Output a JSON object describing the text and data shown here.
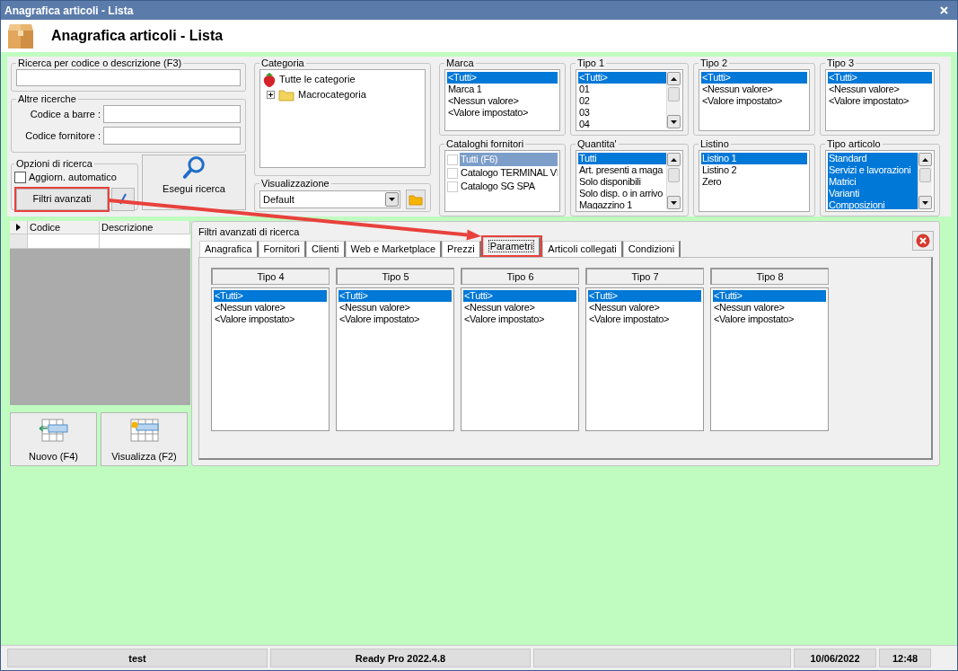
{
  "window": {
    "title": "Anagrafica articoli  - Lista"
  },
  "header": {
    "title": "Anagrafica articoli  - Lista"
  },
  "search": {
    "label": "Ricerca per codice o descrizione (F3)"
  },
  "other_searches": {
    "label": "Altre ricerche",
    "fields": [
      {
        "label": "Codice a barre :"
      },
      {
        "label": "Codice fornitore :"
      }
    ]
  },
  "options": {
    "label": "Opzioni di ricerca",
    "auto_update": {
      "label": "Aggiorn. automatico",
      "checked": false
    },
    "advanced_button": {
      "label": "Filtri avanzati",
      "highlighted": true
    }
  },
  "search_button": {
    "label": "Esegui ricerca"
  },
  "category": {
    "label": "Categoria",
    "tree": [
      {
        "label": "Tutte le categorie",
        "children": [
          {
            "label": "Macrocategoria",
            "expanded": false
          }
        ]
      }
    ]
  },
  "view": {
    "label": "Visualizzazione",
    "value": "Default"
  },
  "filters": [
    {
      "label": "Marca",
      "kind": "list",
      "items": [
        {
          "label": "<Tutti>",
          "selected": true
        },
        {
          "label": "Marca 1",
          "selected": false
        },
        {
          "label": "<Nessun valore>",
          "selected": false
        },
        {
          "label": "<Valore impostato>",
          "selected": false
        }
      ]
    },
    {
      "label": "Tipo 1",
      "kind": "scroll-list",
      "items": [
        {
          "label": "<Tutti>",
          "selected": true
        },
        {
          "label": "01",
          "selected": false
        },
        {
          "label": "02",
          "selected": false
        },
        {
          "label": "03",
          "selected": false
        },
        {
          "label": "04",
          "selected": false
        }
      ]
    },
    {
      "label": "Tipo 2",
      "kind": "list",
      "items": [
        {
          "label": "<Tutti>",
          "selected": true
        },
        {
          "label": "<Nessun valore>",
          "selected": false
        },
        {
          "label": "<Valore impostato>",
          "selected": false
        }
      ]
    },
    {
      "label": "Tipo 3",
      "kind": "list",
      "items": [
        {
          "label": "<Tutti>",
          "selected": true
        },
        {
          "label": "<Nessun valore>",
          "selected": false
        },
        {
          "label": "<Valore impostato>",
          "selected": false
        }
      ]
    },
    {
      "label": "Cataloghi fornitori",
      "kind": "check-list",
      "items": [
        {
          "label": "Tutti (F6)",
          "selected": true,
          "checked": false
        },
        {
          "label": "Catalogo TERMINAL VI",
          "selected": false,
          "checked": false
        },
        {
          "label": "Catalogo SG SPA",
          "selected": false,
          "checked": false
        }
      ]
    },
    {
      "label": "Quantita'",
      "kind": "scroll-list",
      "items": [
        {
          "label": "Tutti",
          "selected": true
        },
        {
          "label": "Art. presenti a maga",
          "selected": false
        },
        {
          "label": "Solo disponibili",
          "selected": false
        },
        {
          "label": "Solo disp. o in arrivo",
          "selected": false
        },
        {
          "label": "Magazzino 1",
          "selected": false
        }
      ]
    },
    {
      "label": "Listino",
      "kind": "list",
      "items": [
        {
          "label": "Listino 1",
          "selected": true
        },
        {
          "label": "Listino 2",
          "selected": false
        },
        {
          "label": "Zero",
          "selected": false
        }
      ]
    },
    {
      "label": "Tipo articolo",
      "kind": "scroll-list",
      "items": [
        {
          "label": "Standard",
          "selected": true
        },
        {
          "label": "Servizi e lavorazioni",
          "selected": true
        },
        {
          "label": "Matrici",
          "selected": true
        },
        {
          "label": "Varianti",
          "selected": true
        },
        {
          "label": "Composizioni",
          "selected": true
        }
      ]
    }
  ],
  "grid": {
    "columns": [
      "Codice",
      "Descrizione"
    ]
  },
  "buttons": [
    {
      "label": "Nuovo (F4)",
      "kind": "new"
    },
    {
      "label": "Visualizza (F2)",
      "kind": "view"
    }
  ],
  "advanced": {
    "title": "Filtri avanzati di ricerca",
    "tabs": [
      {
        "label": "Anagrafica",
        "selected": false,
        "highlighted": false
      },
      {
        "label": "Fornitori",
        "selected": false,
        "highlighted": false
      },
      {
        "label": "Clienti",
        "selected": false,
        "highlighted": false
      },
      {
        "label": "Web e Marketplace",
        "selected": false,
        "highlighted": false
      },
      {
        "label": "Prezzi",
        "selected": false,
        "highlighted": false
      },
      {
        "label": "Parametri",
        "selected": true,
        "highlighted": true
      },
      {
        "label": "Articoli collegati",
        "selected": false,
        "highlighted": false
      },
      {
        "label": "Condizioni",
        "selected": false,
        "highlighted": false
      }
    ],
    "lists": [
      {
        "header": "Tipo 4",
        "items": [
          {
            "label": "<Tutti>",
            "selected": true
          },
          {
            "label": "<Nessun valore>",
            "selected": false
          },
          {
            "label": "<Valore impostato>",
            "selected": false
          }
        ]
      },
      {
        "header": "Tipo 5",
        "items": [
          {
            "label": "<Tutti>",
            "selected": true
          },
          {
            "label": "<Nessun valore>",
            "selected": false
          },
          {
            "label": "<Valore impostato>",
            "selected": false
          }
        ]
      },
      {
        "header": "Tipo 6",
        "items": [
          {
            "label": "<Tutti>",
            "selected": true
          },
          {
            "label": "<Nessun valore>",
            "selected": false
          },
          {
            "label": "<Valore impostato>",
            "selected": false
          }
        ]
      },
      {
        "header": "Tipo 7",
        "items": [
          {
            "label": "<Tutti>",
            "selected": true
          },
          {
            "label": "<Nessun valore>",
            "selected": false
          },
          {
            "label": "<Valore impostato>",
            "selected": false
          }
        ]
      },
      {
        "header": "Tipo 8",
        "items": [
          {
            "label": "<Tutti>",
            "selected": true
          },
          {
            "label": "<Nessun valore>",
            "selected": false
          },
          {
            "label": "<Valore impostato>",
            "selected": false
          }
        ]
      }
    ]
  },
  "status_bar": {
    "left": [
      "test",
      "Ready Pro 2022.4.8"
    ],
    "right": [
      "10/06/2022",
      "12:48"
    ]
  }
}
